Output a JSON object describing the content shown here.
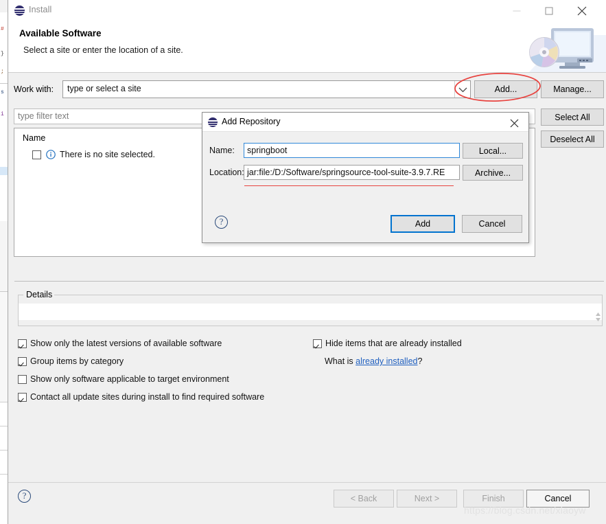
{
  "window": {
    "title": "Install",
    "icon": "eclipse-sphere-icon",
    "controls": {
      "minimize": "minimize-icon",
      "maximize": "maximize-icon",
      "close": "close-icon"
    }
  },
  "header": {
    "title": "Available Software",
    "description": "Select a site or enter the location of a site.",
    "art_icon": "computer-cd-install-icon"
  },
  "work_with": {
    "label": "Work with:",
    "value": "",
    "placeholder": "type or select a site",
    "dropdown_icon": "chevron-down-icon",
    "add_button": "Add...",
    "manage_button": "Manage..."
  },
  "filter": {
    "value": "",
    "placeholder": "type filter text"
  },
  "tree": {
    "column_header": "Name",
    "rows": [
      {
        "checked": false,
        "icon": "info-icon",
        "label": "There is no site selected."
      }
    ],
    "select_all_button": "Select All",
    "deselect_all_button": "Deselect All"
  },
  "details": {
    "group_title": "Details",
    "content": "",
    "scroll_up_icon": "scroll-up-arrow-icon",
    "scroll_down_icon": "scroll-down-arrow-icon"
  },
  "options": {
    "left": [
      {
        "label": "Show only the latest versions of available software",
        "checked": true
      },
      {
        "label": "Group items by category",
        "checked": true
      },
      {
        "label": "Show only software applicable to target environment",
        "checked": false
      },
      {
        "label": "Contact all update sites during install to find required software",
        "checked": true
      }
    ],
    "right": [
      {
        "label": "Hide items that are already installed",
        "checked": true
      }
    ],
    "what_is_prefix": "What is ",
    "what_is_link": "already installed",
    "what_is_suffix": "?"
  },
  "bottom_bar": {
    "help_icon": "?",
    "back_button": "< Back",
    "next_button": "Next >",
    "finish_button": "Finish",
    "cancel_button": "Cancel"
  },
  "watermark": "https://blog.csdn.net/xiaoyw",
  "dialog": {
    "title": "Add Repository",
    "icon": "eclipse-sphere-icon",
    "close_icon": "close-icon",
    "name_label": "Name:",
    "name_value": "springboot",
    "location_label": "Location:",
    "location_value": "jar:file:/D:/Software/springsource-tool-suite-3.9.7.RE",
    "local_button": "Local...",
    "archive_button": "Archive...",
    "help_icon": "?",
    "add_button": "Add",
    "cancel_button": "Cancel"
  },
  "annotations": {
    "ellipse_target": "Add... button",
    "ellipse_color": "#e8433f",
    "underline_target": "Location field",
    "underline_color": "#e8433f"
  },
  "background_sliver": {
    "glyphs": [
      "#",
      "}",
      ";",
      "s",
      "i"
    ]
  },
  "colors": {
    "dialog_focus_border": "#0073cf",
    "field_focus_border": "#2f87d8",
    "link": "#1f5fbf",
    "annotation_red": "#e8433f",
    "window_chrome": "#f0f0f0",
    "eclipse_icon": "#2f2c6d"
  }
}
